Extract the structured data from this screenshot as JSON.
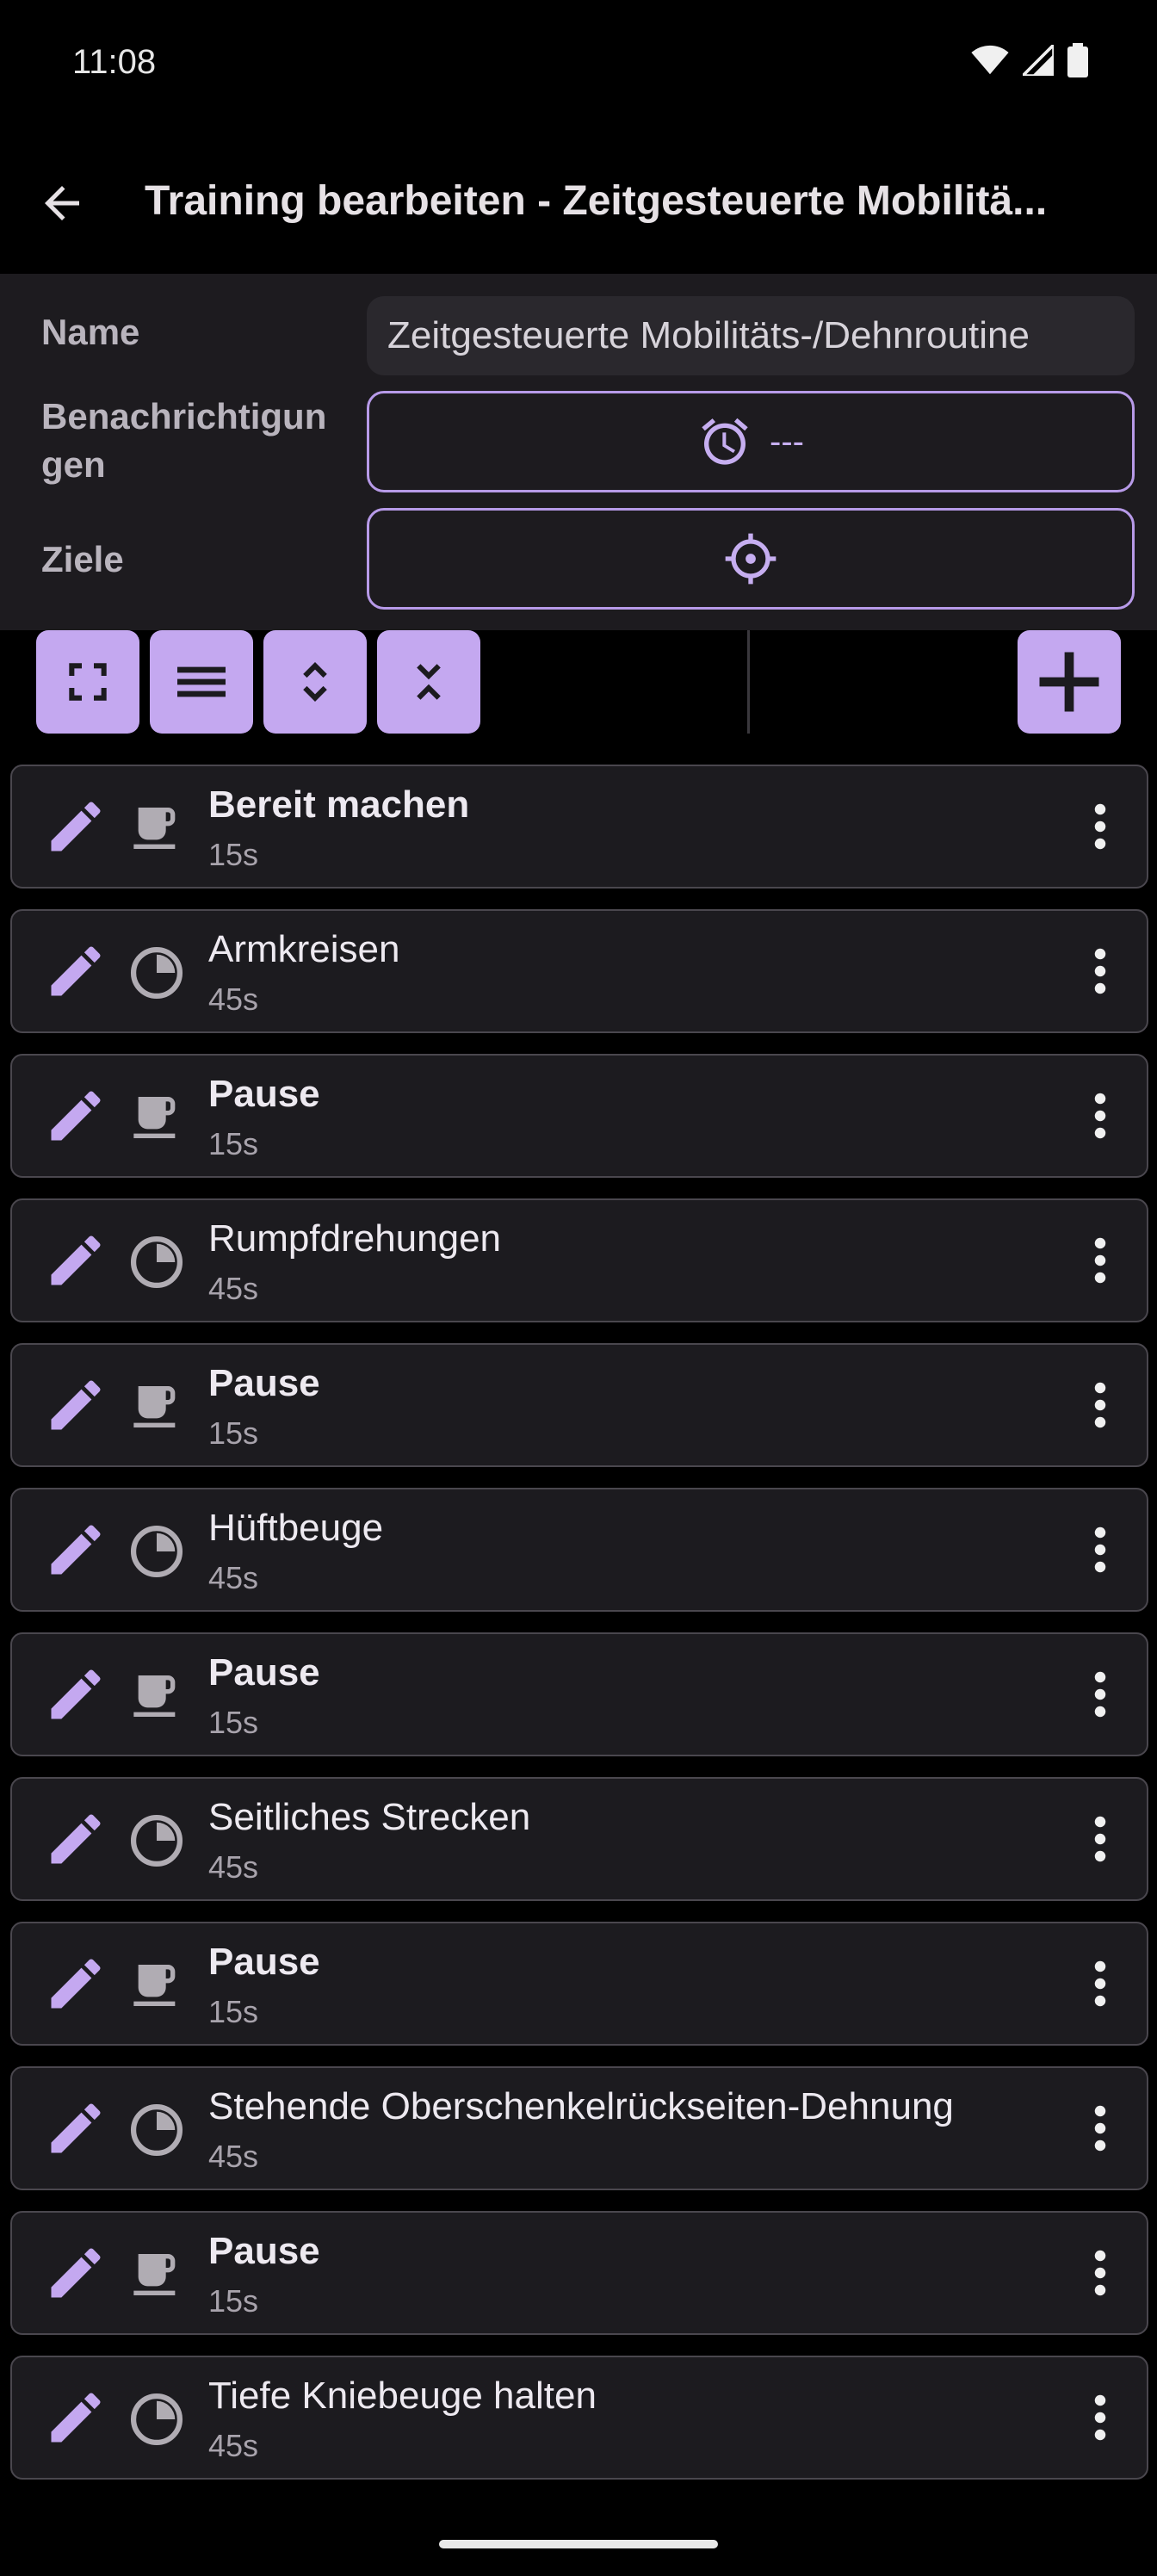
{
  "status_bar": {
    "time": "11:08"
  },
  "app_bar": {
    "title": "Training bearbeiten - Zeitgesteuerte Mobilitä..."
  },
  "form": {
    "name_label": "Name",
    "name_value": "Zeitgesteuerte Mobilitäts-/Dehnroutine",
    "notifications_label": "Benachrichtigun\ngen",
    "notifications_value": "---",
    "goals_label": "Ziele"
  },
  "colors": {
    "accent": "#c4a8f0",
    "surface": "#1c1b1f",
    "background": "#000000"
  },
  "items": [
    {
      "title": "Bereit machen",
      "duration": "15s",
      "type": "rest",
      "bold": true
    },
    {
      "title": "Armkreisen",
      "duration": "45s",
      "type": "timed",
      "bold": false
    },
    {
      "title": "Pause",
      "duration": "15s",
      "type": "rest",
      "bold": true
    },
    {
      "title": "Rumpfdrehungen",
      "duration": "45s",
      "type": "timed",
      "bold": false
    },
    {
      "title": "Pause",
      "duration": "15s",
      "type": "rest",
      "bold": true
    },
    {
      "title": "Hüftbeuge",
      "duration": "45s",
      "type": "timed",
      "bold": false
    },
    {
      "title": "Pause",
      "duration": "15s",
      "type": "rest",
      "bold": true
    },
    {
      "title": "Seitliches Strecken",
      "duration": "45s",
      "type": "timed",
      "bold": false
    },
    {
      "title": "Pause",
      "duration": "15s",
      "type": "rest",
      "bold": true
    },
    {
      "title": "Stehende Oberschenkelrückseiten-Dehnung",
      "duration": "45s",
      "type": "timed",
      "bold": false
    },
    {
      "title": "Pause",
      "duration": "15s",
      "type": "rest",
      "bold": true
    },
    {
      "title": "Tiefe Kniebeuge halten",
      "duration": "45s",
      "type": "timed",
      "bold": false
    }
  ]
}
